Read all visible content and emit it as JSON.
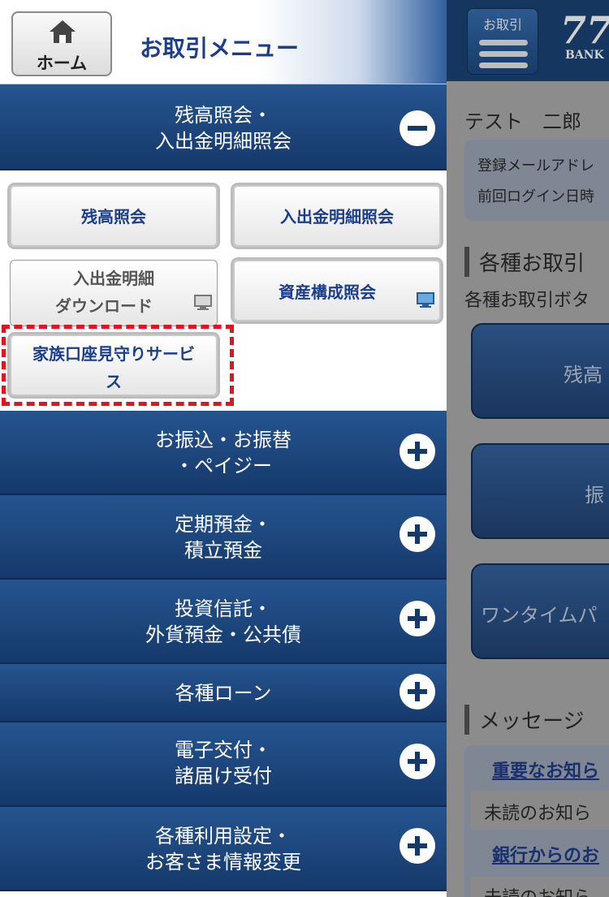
{
  "background": {
    "menu_button_label": "お取引",
    "logo_number": "77",
    "logo_bank": "BANK",
    "user_name": "テスト　二郎",
    "info_lines": [
      "登録メールアドレ",
      "前回ログイン日時"
    ],
    "section_transactions": "各種お取引",
    "section_transactions_desc": "各種お取引ボタ",
    "big_buttons": [
      "残高",
      "振",
      "ワンタイムパ"
    ],
    "section_messages": "メッセージ",
    "message_links": [
      "重要なお知ら",
      "銀行からのお"
    ],
    "message_unread": [
      "未読のお知ら",
      "未読のお知ら"
    ]
  },
  "drawer": {
    "home_label": "ホーム",
    "title": "お取引メニュー",
    "expanded_category": {
      "line1": "残高照会・",
      "line2": "入出金明細照会"
    },
    "sub_buttons": {
      "balance": "残高照会",
      "statement": "入出金明細照会",
      "download_line1": "入出金明細",
      "download_line2": "ダウンロード",
      "assets": "資産構成照会",
      "family_line1": "家族口座見守りサービ",
      "family_line2": "ス"
    },
    "categories": [
      {
        "line1": "お振込・お振替",
        "line2": "・ペイジー"
      },
      {
        "line1": "定期預金・",
        "line2": "積立預金"
      },
      {
        "line1": "投資信託・",
        "line2": "外貨預金・公共債"
      },
      {
        "line1": "各種ローン",
        "line2": ""
      },
      {
        "line1": "電子交付・",
        "line2": "諸届け受付"
      },
      {
        "line1": "各種利用設定・",
        "line2": "お客さま情報変更"
      }
    ]
  },
  "colors": {
    "navy": "#15396b",
    "title_blue": "#1b3e8c",
    "highlight_red": "#e0151f"
  }
}
